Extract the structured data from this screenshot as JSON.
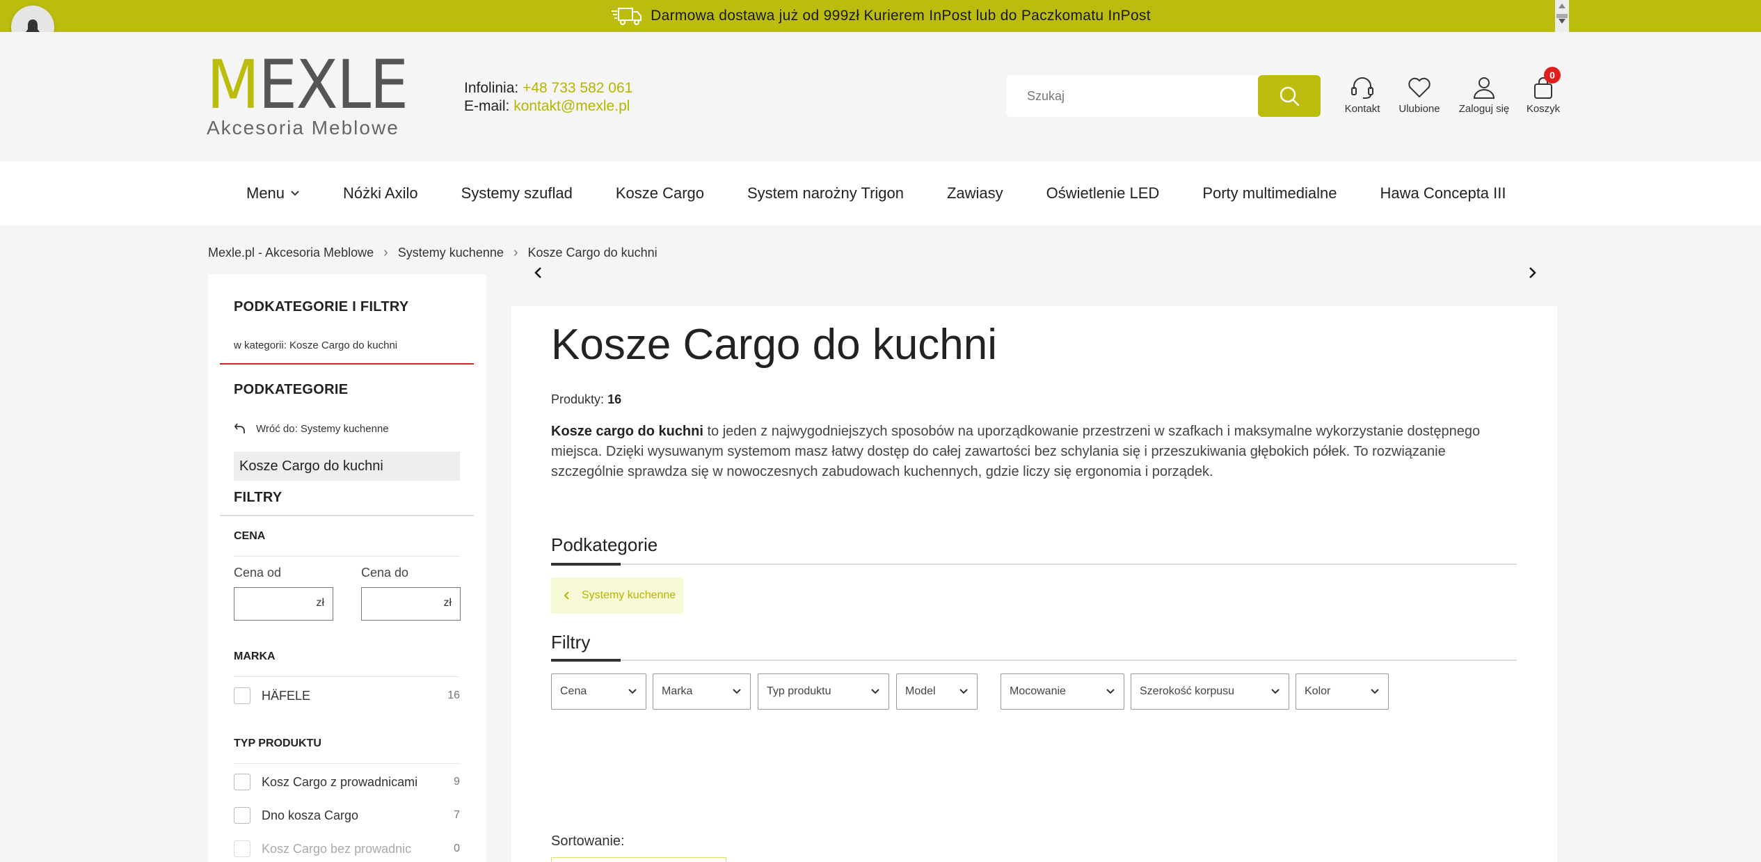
{
  "topbar": {
    "text": "Darmowa dostawa już od 999zł Kurierem InPost lub do Paczkomatu InPost",
    "truck_icon": "truck-icon"
  },
  "logo": {
    "main_first": "M",
    "main_rest": "EXLE",
    "sub": "Akcesoria Meblowe"
  },
  "contact": {
    "phone_label": "Infolinia:",
    "phone": "+48 733 582 061",
    "email_label": "E-mail:",
    "email": "kontakt@mexle.pl"
  },
  "search": {
    "placeholder": "Szukaj"
  },
  "header_icons": {
    "contact": "Kontakt",
    "favorites": "Ulubione",
    "login": "Zaloguj się",
    "cart": "Koszyk",
    "cart_count": "0"
  },
  "nav": {
    "items": [
      "Menu",
      "Nóżki Axilo",
      "Systemy szuflad",
      "Kosze Cargo",
      "System narożny Trigon",
      "Zawiasy",
      "Oświetlenie LED",
      "Porty multimedialne",
      "Hawa Concepta III"
    ]
  },
  "breadcrumb": {
    "items": [
      "Mexle.pl - Akcesoria Meblowe",
      "Systemy kuchenne",
      "Kosze Cargo do kuchni"
    ]
  },
  "sidebar": {
    "title": "PODKATEGORIE I FILTRY",
    "in_category": "w kategorii: Kosze Cargo do kuchni",
    "subcategories_title": "PODKATEGORIE",
    "back_to": "Wróć do: Systemy kuchenne",
    "active": "Kosze Cargo do kuchni",
    "filters_title": "FILTRY",
    "price": {
      "heading": "CENA",
      "from_label": "Cena od",
      "to_label": "Cena do",
      "currency": "zł"
    },
    "brand": {
      "heading": "MARKA",
      "items": [
        {
          "label": "HÄFELE",
          "count": "16"
        }
      ]
    },
    "product_type": {
      "heading": "TYP PRODUKTU",
      "items": [
        {
          "label": "Kosz Cargo z prowadnicami",
          "count": "9"
        },
        {
          "label": "Dno kosza Cargo",
          "count": "7"
        },
        {
          "label": "Kosz Cargo bez prowadnic",
          "count": "0"
        }
      ]
    }
  },
  "main": {
    "title": "Kosze Cargo do kuchni",
    "products_label": "Produkty:",
    "products_count": "16",
    "desc_bold": "Kosze cargo do kuchni",
    "desc_rest": " to jeden z najwygodniejszych sposobów na uporządkowanie przestrzeni w szafkach i maksymalne wykorzystanie dostępnego miejsca. Dzięki wysuwanym systemom masz łatwy dostęp do całej zawartości bez schylania się i przeszukiwania głębokich półek. To rozwiązanie szczególnie sprawdza się w nowoczesnych zabudowach kuchennych, gdzie liczy się ergonomia i porządek.",
    "subcategories_title": "Podkategorie",
    "subcategory_back": "Systemy kuchenne",
    "filters_title": "Filtry",
    "filters": [
      "Cena",
      "Marka",
      "Typ produktu",
      "Model",
      "Mocowanie",
      "Szerokość korpusu",
      "Kolor"
    ],
    "sort_label": "Sortowanie:"
  },
  "colors": {
    "accent": "#bcbc0e",
    "red": "#c62828"
  }
}
